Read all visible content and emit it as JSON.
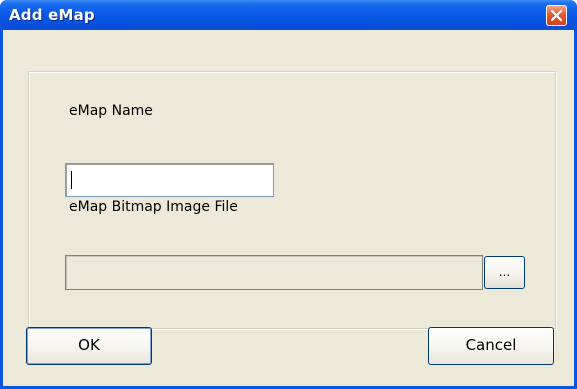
{
  "window": {
    "title": "Add eMap"
  },
  "form": {
    "name_label": "eMap Name",
    "name_value": "",
    "file_label": "eMap Bitmap Image File",
    "file_value": "",
    "browse_label": "..."
  },
  "buttons": {
    "ok_label": "OK",
    "cancel_label": "Cancel"
  },
  "icons": {
    "close": "close-icon"
  },
  "colors": {
    "titlebar": "#0a5ae8",
    "close_button": "#d4421d",
    "dialog_background": "#ece9d8"
  }
}
